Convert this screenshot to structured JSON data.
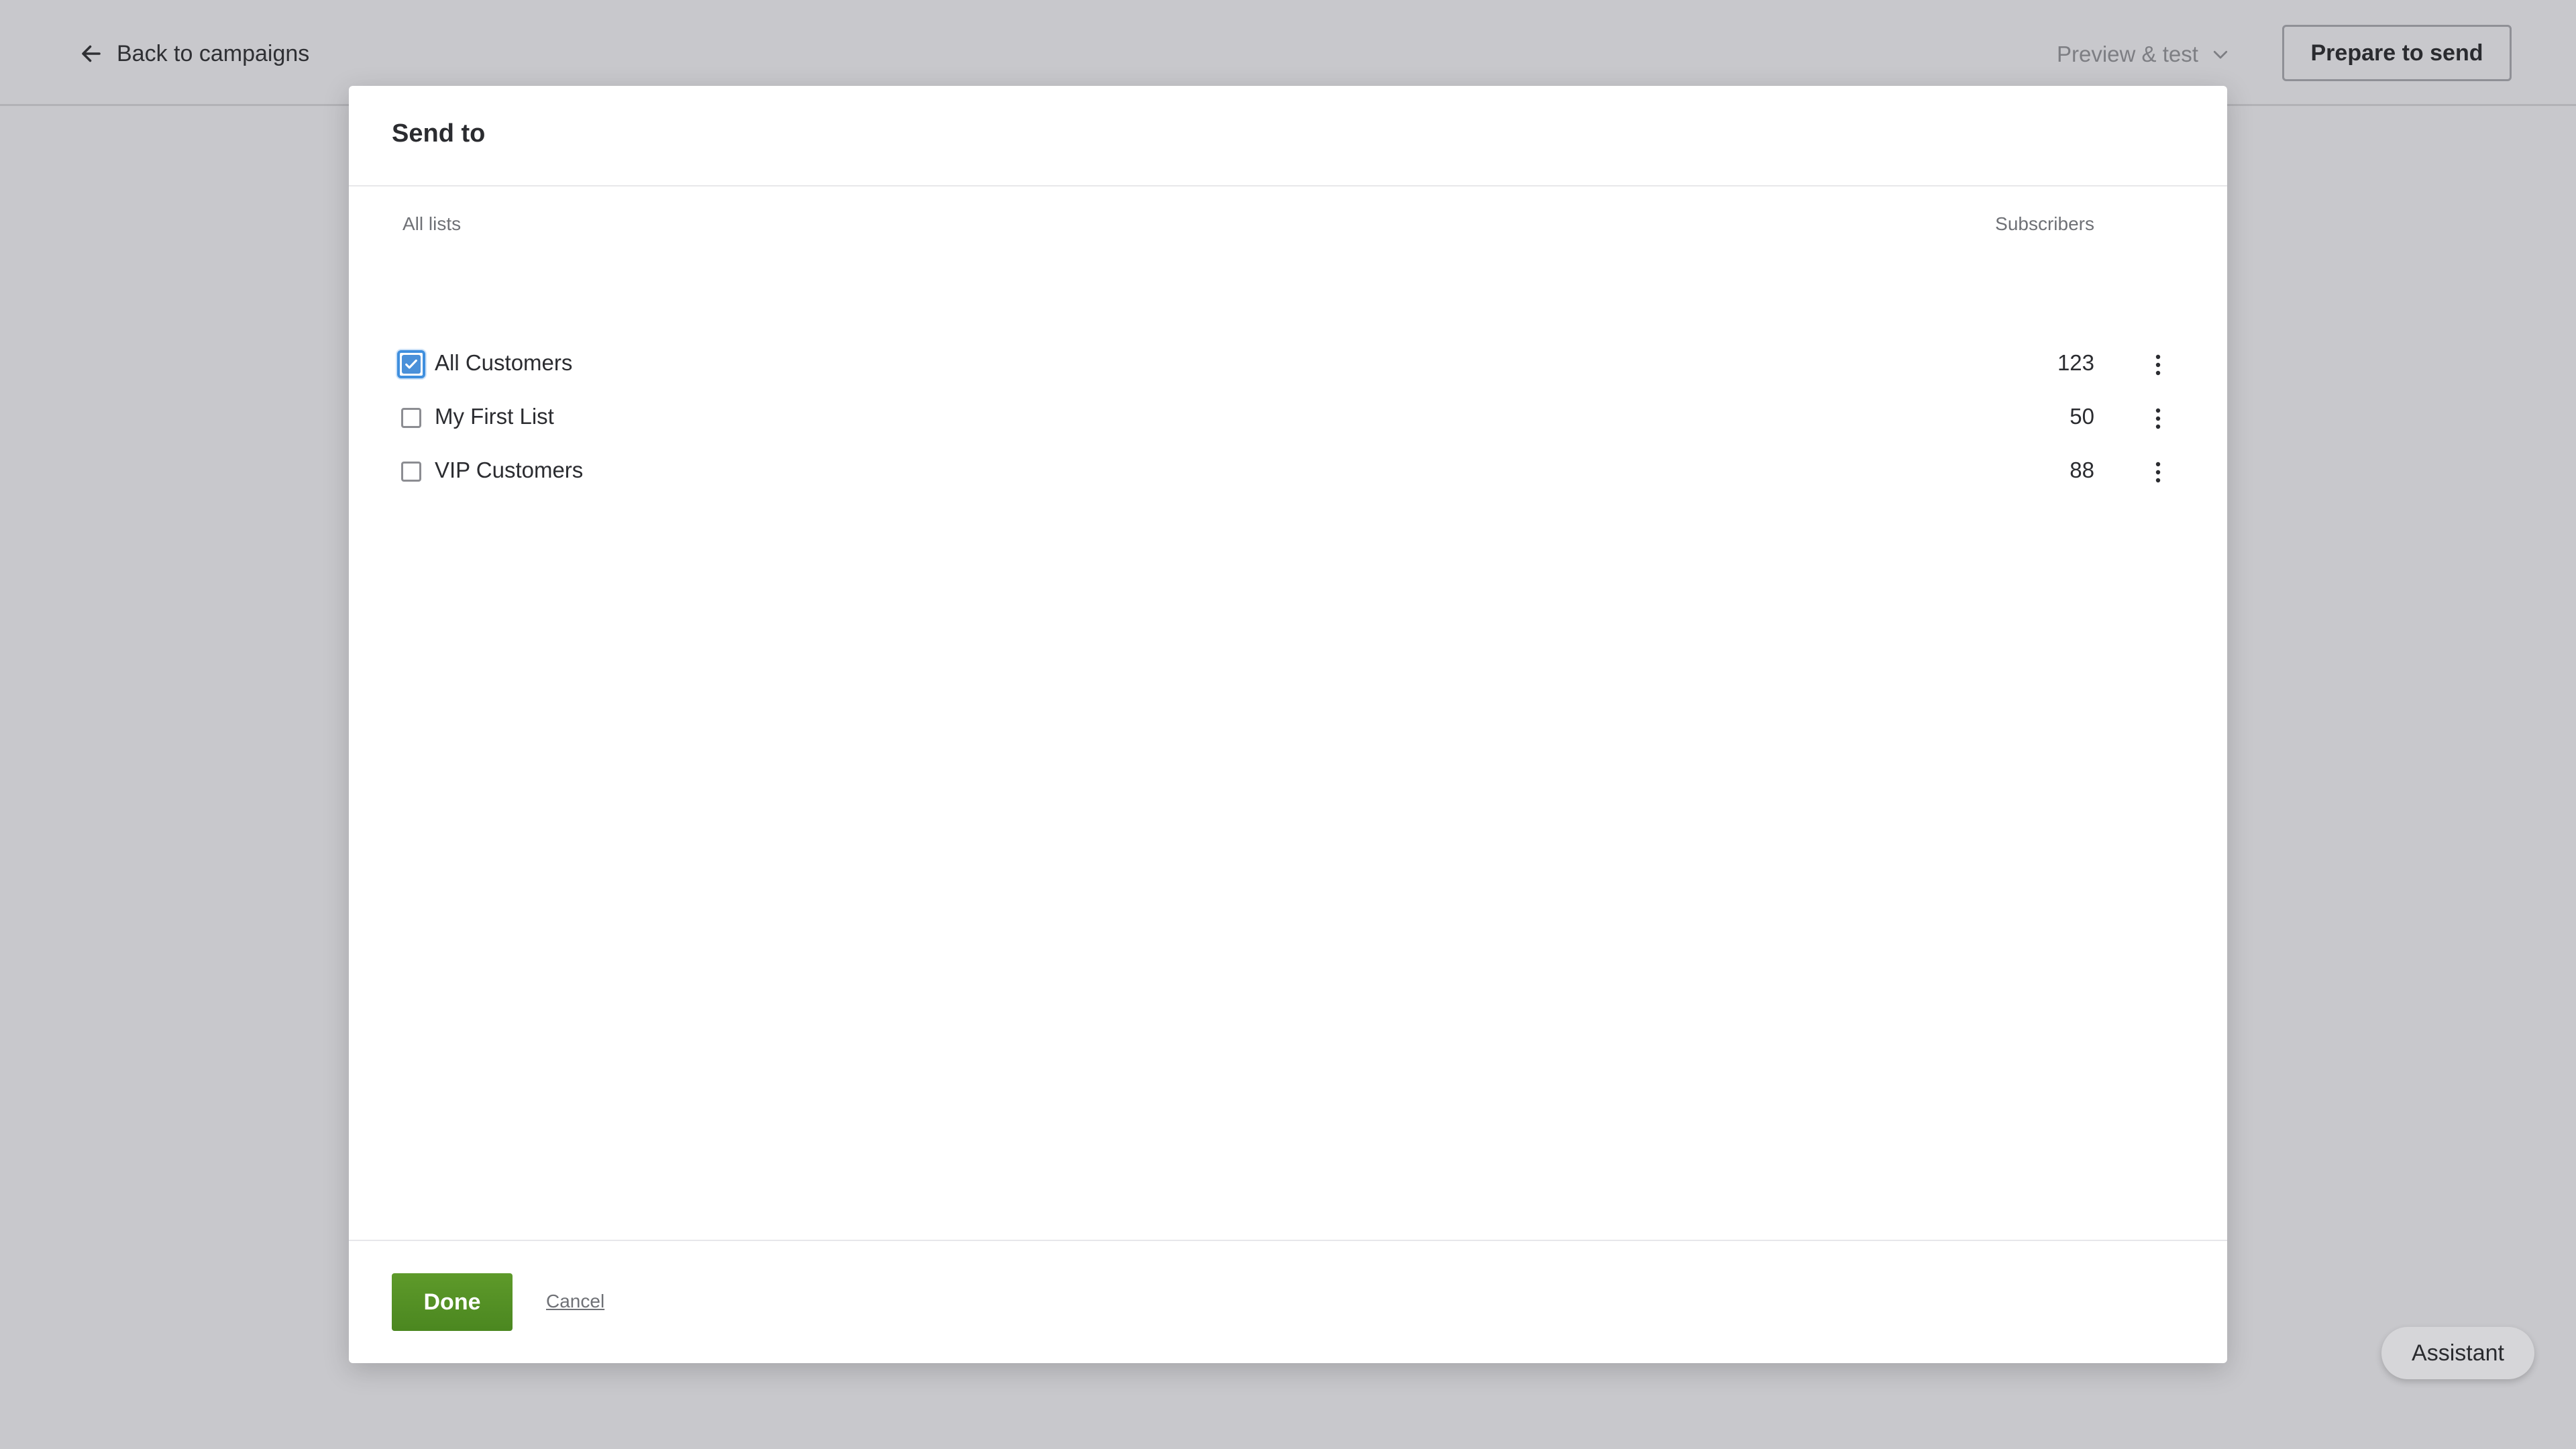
{
  "topbar": {
    "back_label": "Back to campaigns",
    "preview_label": "Preview & test",
    "prepare_label": "Prepare to send"
  },
  "assistant_label": "Assistant",
  "modal": {
    "title": "Send to",
    "col_lists": "All lists",
    "col_subscribers": "Subscribers",
    "lists": [
      {
        "name": "All Customers",
        "subscribers": "123",
        "checked": true
      },
      {
        "name": "My First List",
        "subscribers": "50",
        "checked": false
      },
      {
        "name": "VIP Customers",
        "subscribers": "88",
        "checked": false
      }
    ],
    "done_label": "Done",
    "cancel_label": "Cancel"
  },
  "colors": {
    "accent_green": "#4b8720",
    "checkbox_blue": "#4a90d9"
  },
  "icons": [
    "arrow-left-icon",
    "chevron-down-icon",
    "check-icon",
    "kebab-icon"
  ]
}
